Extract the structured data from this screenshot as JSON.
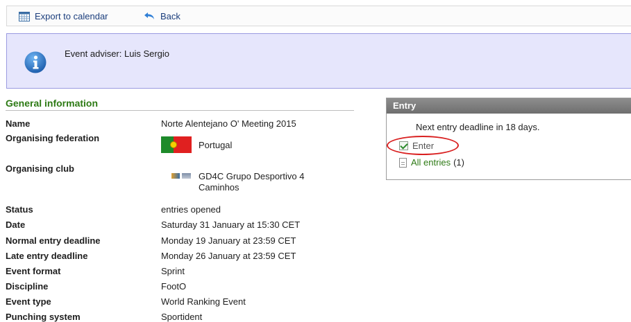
{
  "toolbar": {
    "export_label": "Export to calendar",
    "back_label": "Back"
  },
  "info": {
    "text": "Event adviser: Luis Sergio"
  },
  "general": {
    "title": "General information",
    "rows": [
      {
        "label": "Name",
        "value": "Norte Alentejano O' Meeting 2015"
      },
      {
        "label": "Organising federation",
        "value": "Portugal"
      },
      {
        "label": "Organising club",
        "value": "GD4C Grupo Desportivo 4",
        "value2": "Caminhos"
      },
      {
        "label": "Status",
        "value": "entries opened"
      },
      {
        "label": "Date",
        "value": "Saturday 31 January at 15:30 CET"
      },
      {
        "label": "Normal entry deadline",
        "value": "Monday 19 January at 23:59 CET"
      },
      {
        "label": "Late entry deadline",
        "value": "Monday 26 January at 23:59 CET"
      },
      {
        "label": "Event format",
        "value": "Sprint"
      },
      {
        "label": "Discipline",
        "value": "FootO"
      },
      {
        "label": "Event type",
        "value": "World Ranking Event"
      },
      {
        "label": "Punching system",
        "value": "Sportident"
      }
    ]
  },
  "entry": {
    "title": "Entry",
    "deadline_text": "Next entry deadline in 18 days.",
    "enter_label": "Enter",
    "all_entries_label": "All entries",
    "all_entries_count": "(1)"
  },
  "colors": {
    "accent_green": "#2d7a14",
    "info_bg": "#e6e6fc",
    "highlight_ring": "#d92020"
  }
}
